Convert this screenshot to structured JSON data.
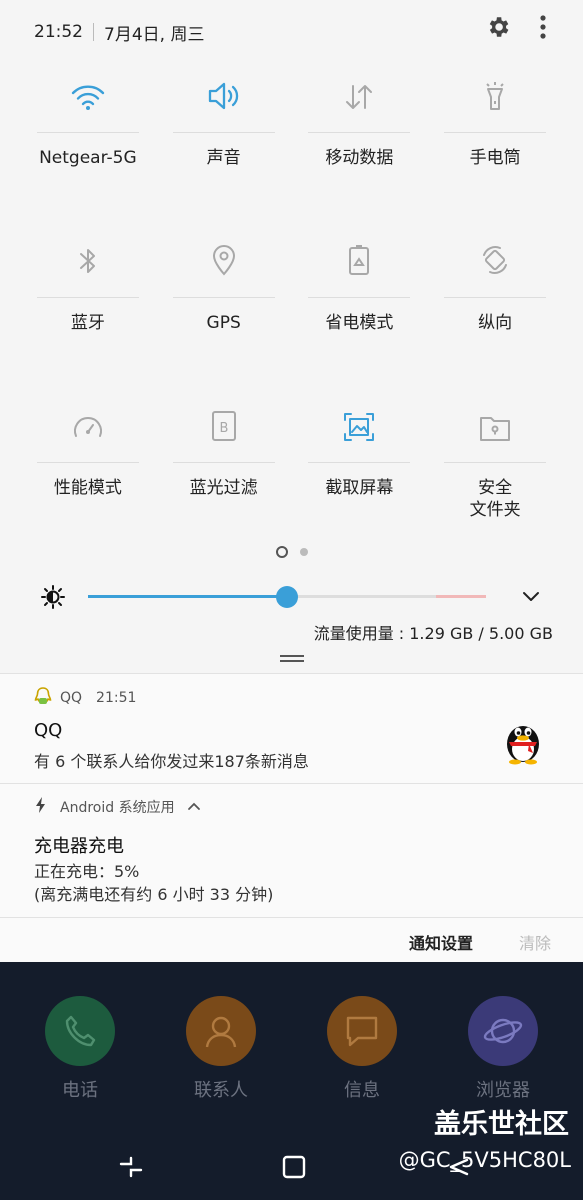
{
  "status_bar": {
    "time": "21:52",
    "date": "7月4日, 周三"
  },
  "quick_tiles": [
    [
      {
        "label": "Netgear-5G",
        "icon": "wifi-icon",
        "active": true
      },
      {
        "label": "声音",
        "icon": "speaker-icon",
        "active": true
      },
      {
        "label": "移动数据",
        "icon": "mobile-data-icon",
        "active": false
      },
      {
        "label": "手电筒",
        "icon": "flashlight-icon",
        "active": false
      }
    ],
    [
      {
        "label": "蓝牙",
        "icon": "bluetooth-icon",
        "active": false
      },
      {
        "label": "GPS",
        "icon": "location-icon",
        "active": false
      },
      {
        "label": "省电模式",
        "icon": "battery-saver-icon",
        "active": false
      },
      {
        "label": "纵向",
        "icon": "rotate-icon",
        "active": false
      }
    ],
    [
      {
        "label": "性能模式",
        "icon": "gauge-icon",
        "active": false
      },
      {
        "label": "蓝光过滤",
        "icon": "blue-light-filter-icon",
        "active": false
      },
      {
        "label": "截取屏幕",
        "icon": "screenshot-icon",
        "active": true
      },
      {
        "label": "安全\n文件夹",
        "icon": "secure-folder-icon",
        "active": false
      }
    ]
  ],
  "brightness": {
    "level": 0.5
  },
  "data_usage": "流量使用量 : 1.29 GB / 5.00 GB",
  "notifications": {
    "qq": {
      "app": "QQ",
      "time": "21:51",
      "title": "QQ",
      "text": "有 6 个联系人给你发过来187条新消息"
    },
    "android": {
      "app": "Android 系统应用",
      "title": "充电器充电",
      "line1": "正在充电：5%",
      "line2": "(离充满电还有约 6 小时 33 分钟)"
    }
  },
  "actions": {
    "settings": "通知设置",
    "clear": "清除"
  },
  "dock": [
    {
      "label": "电话",
      "icon": "phone-icon",
      "color": "#1d5b3e"
    },
    {
      "label": "联系人",
      "icon": "contacts-icon",
      "color": "#7a4a19"
    },
    {
      "label": "信息",
      "icon": "messages-icon",
      "color": "#7a4a19"
    },
    {
      "label": "浏览器",
      "icon": "browser-icon",
      "color": "#3b3a78"
    }
  ],
  "watermark": {
    "title": "盖乐世社区",
    "user": "@GC_5V5HC80L"
  },
  "colors": {
    "accent": "#3a9fd8",
    "inactive": "#a8a8a8"
  }
}
